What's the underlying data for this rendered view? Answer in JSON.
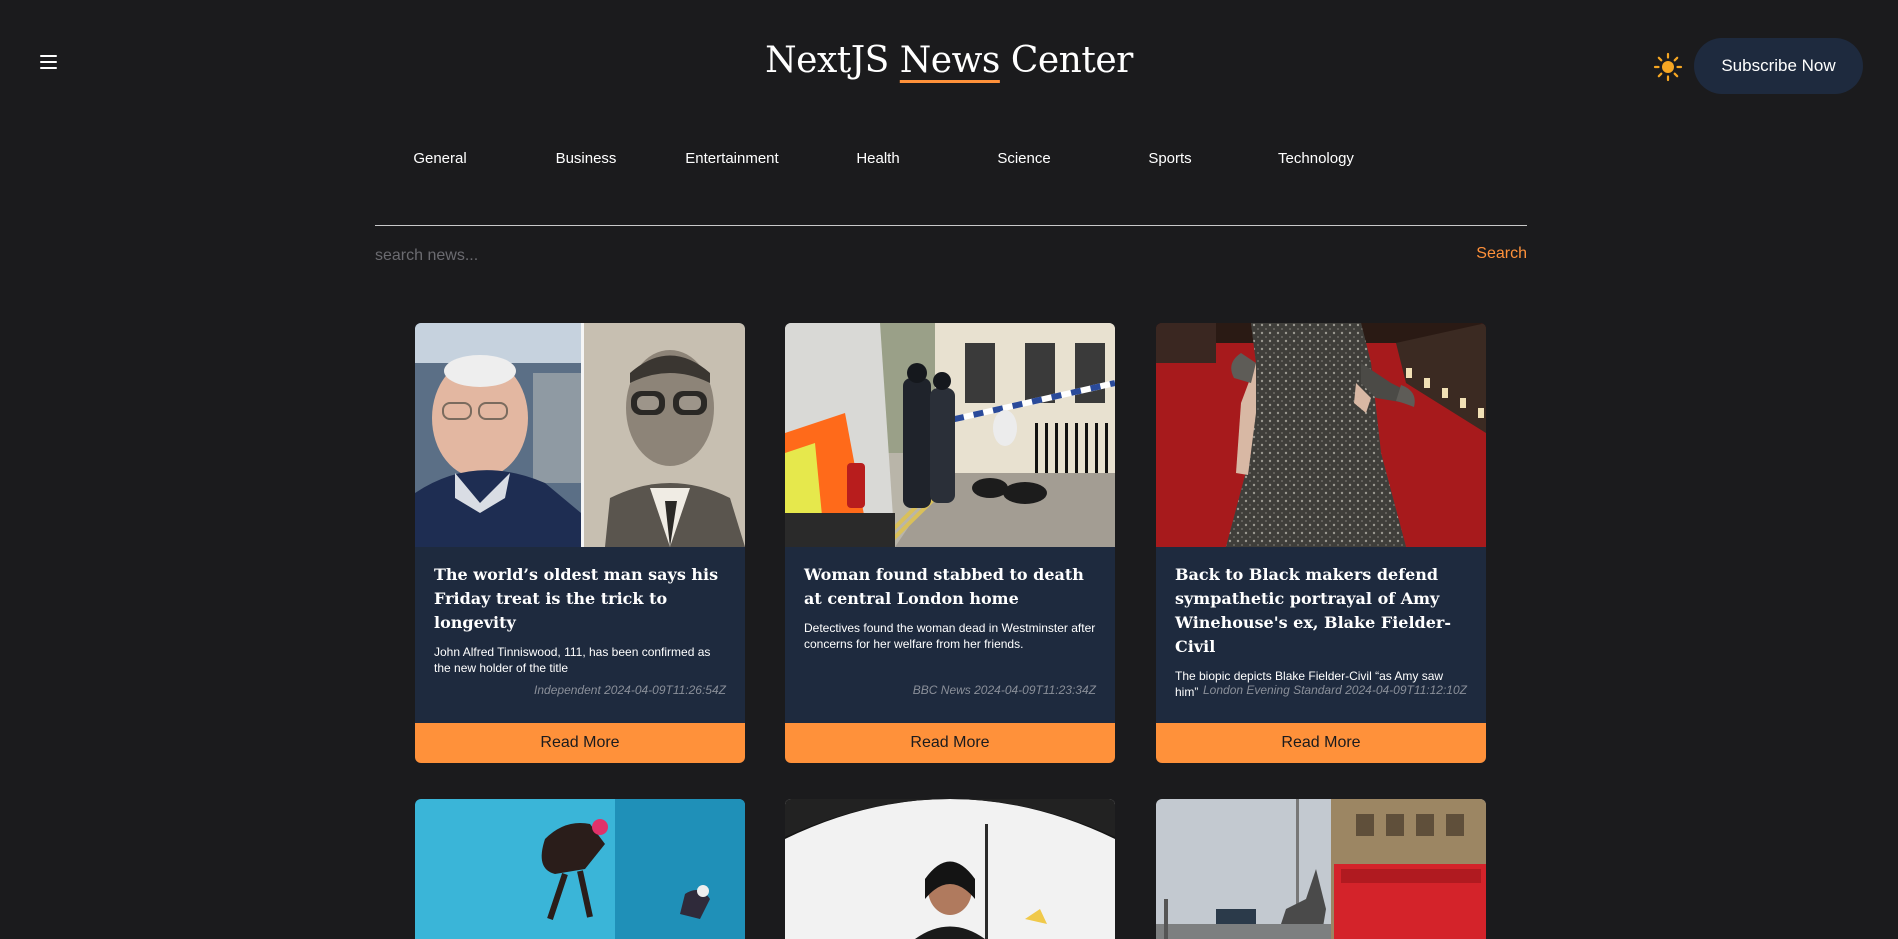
{
  "header": {
    "brand_prefix": "NextJS ",
    "brand_underlined": "News",
    "brand_suffix": " Center",
    "subscribe_label": "Subscribe Now",
    "theme_icon": "sun-icon",
    "menu_icon": "hamburger-icon",
    "accent_color": "#ff913a"
  },
  "nav": {
    "items": [
      "General",
      "Business",
      "Entertainment",
      "Health",
      "Science",
      "Sports",
      "Technology"
    ]
  },
  "search": {
    "placeholder": "search news...",
    "button_label": "Search"
  },
  "articles": [
    {
      "title": "The world’s oldest man says his Friday treat is the trick to longevity",
      "description": "John Alfred Tinniswood, 111, has been confirmed as the new holder of the title",
      "source": "Independent",
      "published": "2024-04-09T11:26:54Z",
      "button_label": "Read More"
    },
    {
      "title": "Woman found stabbed to death at central London home",
      "description": "Detectives found the woman dead in Westminster after concerns for her welfare from her friends.",
      "source": "BBC News",
      "published": "2024-04-09T11:23:34Z",
      "button_label": "Read More"
    },
    {
      "title": "Back to Black makers defend sympathetic portrayal of Amy Winehouse's ex, Blake Fielder-Civil",
      "description": "The biopic depicts Blake Fielder-Civil “as Amy saw him”",
      "source": "London Evening Standard",
      "published": "2024-04-09T11:12:10Z",
      "button_label": "Read More"
    }
  ]
}
